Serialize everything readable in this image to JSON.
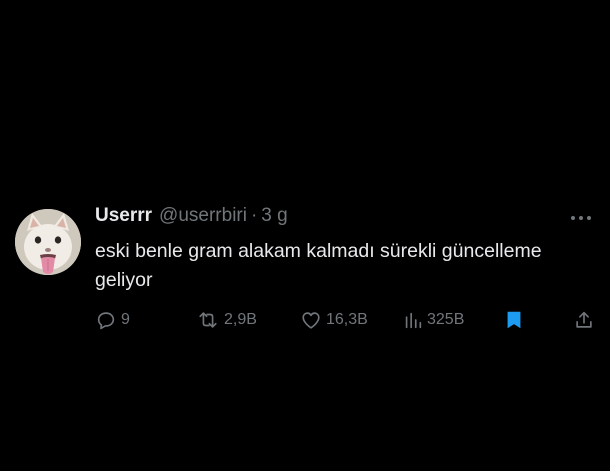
{
  "tweet": {
    "display_name": "Userrr",
    "handle": "@userrbiri",
    "separator": "·",
    "time": "3 g",
    "text": "eski benle gram alakam kalmadı sürekli güncelleme geliyor",
    "icons": {
      "more": "more-horizontal-icon",
      "avatar": "cat-avatar"
    }
  },
  "actions": {
    "reply_count": "9",
    "retweet_count": "2,9B",
    "like_count": "16,3B",
    "views_count": "325B",
    "bookmark_active": true
  },
  "colors": {
    "background": "#000000",
    "text_primary": "#e7e9ea",
    "text_secondary": "#71767b",
    "bookmark_accent": "#1d9bf0"
  }
}
